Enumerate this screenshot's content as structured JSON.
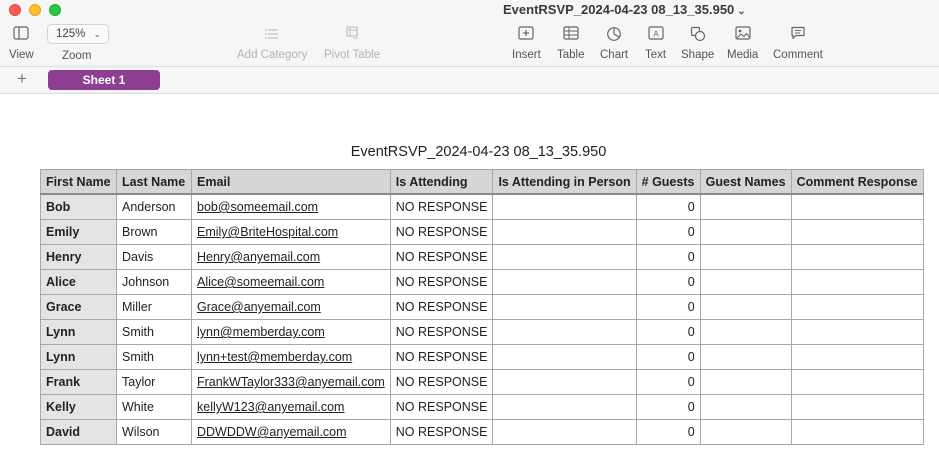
{
  "window": {
    "title": "EventRSVP_2024-04-23 08_13_35.950"
  },
  "toolbar": {
    "view_label": "View",
    "zoom_value": "125%",
    "zoom_label": "Zoom",
    "add_category_label": "Add Category",
    "pivot_table_label": "Pivot Table",
    "insert_label": "Insert",
    "table_label": "Table",
    "chart_label": "Chart",
    "text_label": "Text",
    "shape_label": "Shape",
    "media_label": "Media",
    "comment_label": "Comment"
  },
  "sheets": {
    "add_icon": "+",
    "active_tab": "Sheet 1"
  },
  "table": {
    "title": "EventRSVP_2024-04-23 08_13_35.950",
    "headers": [
      "First Name",
      "Last Name",
      "Email",
      "Is Attending",
      "Is Attending in Person",
      "# Guests",
      "Guest Names",
      "Comment Response"
    ],
    "rows": [
      [
        "Bob",
        "Anderson",
        "bob@someemail.com",
        "NO RESPONSE",
        "",
        "0",
        "",
        ""
      ],
      [
        "Emily",
        "Brown",
        "Emily@BriteHospital.com",
        "NO RESPONSE",
        "",
        "0",
        "",
        ""
      ],
      [
        "Henry",
        "Davis",
        "Henry@anyemail.com",
        "NO RESPONSE",
        "",
        "0",
        "",
        ""
      ],
      [
        "Alice",
        "Johnson",
        "Alice@someemail.com",
        "NO RESPONSE",
        "",
        "0",
        "",
        ""
      ],
      [
        "Grace",
        "Miller",
        "Grace@anyemail.com",
        "NO RESPONSE",
        "",
        "0",
        "",
        ""
      ],
      [
        "Lynn",
        "Smith",
        "lynn@memberday.com",
        "NO RESPONSE",
        "",
        "0",
        "",
        ""
      ],
      [
        "Lynn",
        "Smith",
        "lynn+test@memberday.com",
        "NO RESPONSE",
        "",
        "0",
        "",
        ""
      ],
      [
        "Frank",
        "Taylor",
        "FrankWTaylor333@anyemail.com",
        "NO RESPONSE",
        "",
        "0",
        "",
        ""
      ],
      [
        "Kelly",
        "White",
        "kellyW123@anyemail.com",
        "NO RESPONSE",
        "",
        "0",
        "",
        ""
      ],
      [
        "David",
        "Wilson",
        "DDWDDW@anyemail.com",
        "NO RESPONSE",
        "",
        "0",
        "",
        ""
      ]
    ]
  },
  "colors": {
    "sheet_tab": "#8e3f94",
    "header_bg": "#d6d6d6"
  }
}
